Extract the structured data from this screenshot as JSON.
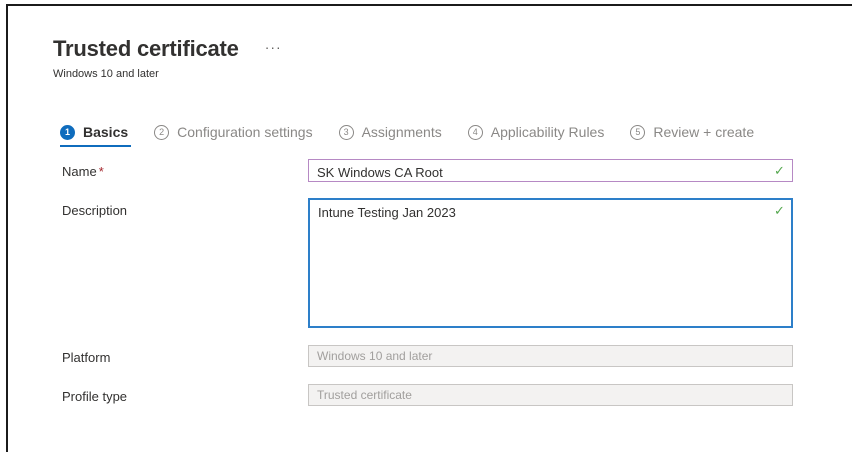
{
  "header": {
    "title": "Trusted certificate",
    "more_label": "···",
    "subtitle": "Windows 10 and later"
  },
  "wizard": {
    "steps": [
      {
        "number": "1",
        "label": "Basics",
        "active": true
      },
      {
        "number": "2",
        "label": "Configuration settings",
        "active": false
      },
      {
        "number": "3",
        "label": "Assignments",
        "active": false
      },
      {
        "number": "4",
        "label": "Applicability Rules",
        "active": false
      },
      {
        "number": "5",
        "label": "Review + create",
        "active": false
      }
    ]
  },
  "form": {
    "name": {
      "label": "Name",
      "required_marker": "*",
      "value": "SK Windows CA Root",
      "valid_icon": "checkmark-icon"
    },
    "description": {
      "label": "Description",
      "value": "Intune Testing Jan 2023",
      "valid_icon": "checkmark-icon"
    },
    "platform": {
      "label": "Platform",
      "value": "Windows 10 and later"
    },
    "profile_type": {
      "label": "Profile type",
      "value": "Trusted certificate"
    }
  },
  "colors": {
    "accent": "#0f6cbd",
    "required": "#a4262c",
    "valid": "#55a84f",
    "name_border": "#b689c4",
    "focus_border": "#2d7fc9"
  }
}
